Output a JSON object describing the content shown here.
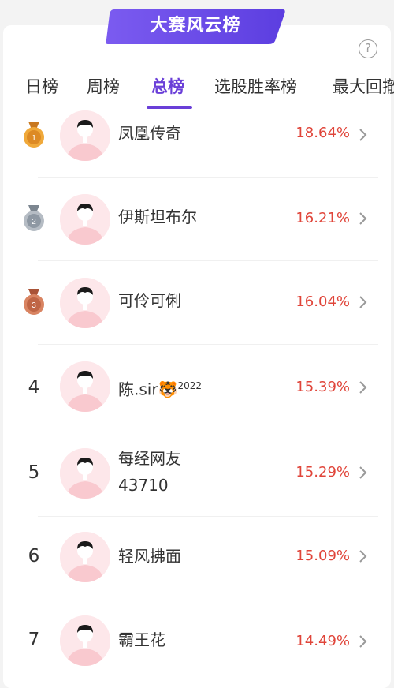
{
  "banner": {
    "title": "大赛风云榜"
  },
  "help_symbol": "?",
  "tabs": [
    "日榜",
    "周榜",
    "总榜",
    "选股胜率榜",
    "最大回撤"
  ],
  "active_tab": "总榜",
  "rankings": [
    {
      "rank": "1",
      "medal": "gold",
      "name": "凤凰传奇",
      "percent": "18.64%"
    },
    {
      "rank": "2",
      "medal": "silver",
      "name": "伊斯坦布尔",
      "percent": "16.21%"
    },
    {
      "rank": "3",
      "medal": "bronze",
      "name": "可伶可俐",
      "percent": "16.04%"
    },
    {
      "rank": "4",
      "name": "陈.sir",
      "name_suffix": "2022",
      "emoji": "🐯",
      "percent": "15.39%"
    },
    {
      "rank": "5",
      "name": "每经网友",
      "name_line2": "43710",
      "percent": "15.29%"
    },
    {
      "rank": "6",
      "name": "轻风拂面",
      "percent": "15.09%"
    },
    {
      "rank": "7",
      "name": "霸王花",
      "percent": "14.49%"
    }
  ],
  "colors": {
    "accent": "#6a3fd8",
    "percent": "#e0453a",
    "gold": "#d98a2b",
    "silver": "#9aa3ad",
    "bronze": "#c86f4f",
    "avatar_bg": "#fde7ea"
  },
  "icons": {
    "chevron": "chevron-right-icon",
    "help": "help-icon",
    "medal": "medal-icon"
  }
}
